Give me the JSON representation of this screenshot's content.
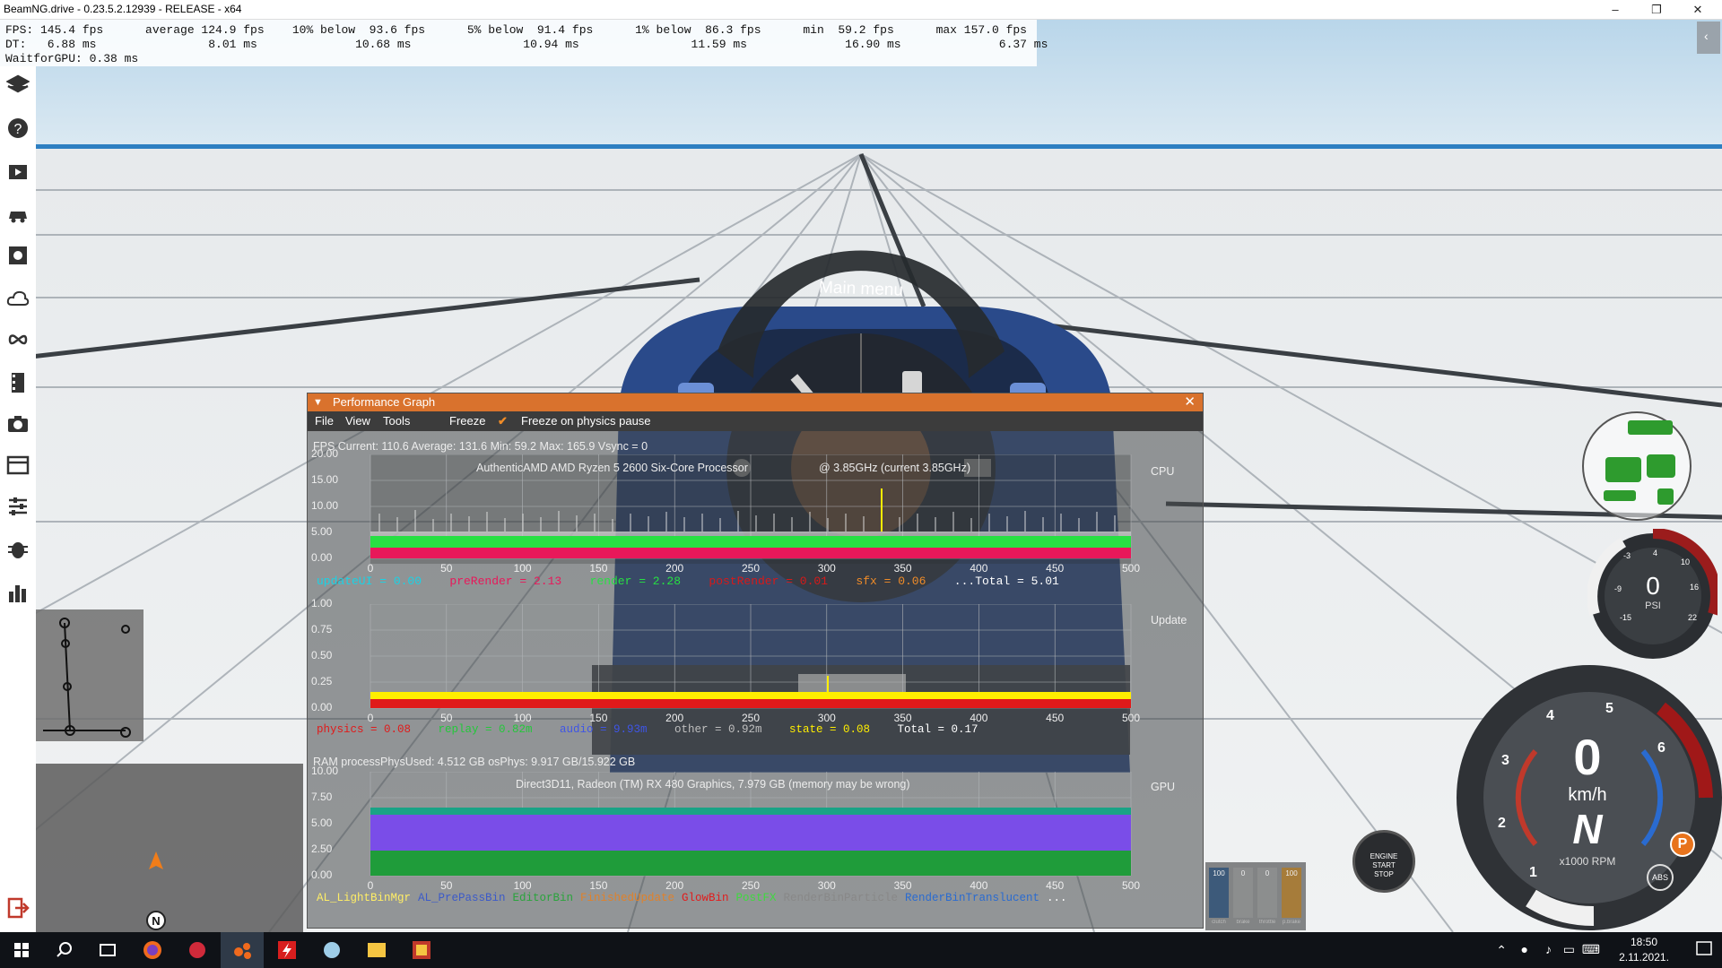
{
  "window": {
    "title": "BeamNG.drive - 0.23.5.2.12939 - RELEASE - x64",
    "min": "–",
    "max": "❐",
    "close": "✕"
  },
  "fps_overlay": {
    "line1": "FPS: 145.4 fps      average 124.9 fps    10% below  93.6 fps      5% below  91.4 fps      1% below  86.3 fps      min  59.2 fps      max 157.0 fps",
    "line2": "DT:   6.88 ms                8.01 ms              10.68 ms                10.94 ms                11.59 ms              16.90 ms              6.37 ms",
    "line3": "WaitforGPU: 0.38 ms"
  },
  "radial_menu": {
    "title": "Main menu"
  },
  "perf": {
    "title": "Performance Graph",
    "menu": {
      "file": "File",
      "view": "View",
      "tools": "Tools",
      "freeze": "Freeze",
      "freeze_physics": "Freeze on physics pause"
    },
    "fps_line": "FPS  Current: 110.6  Average: 131.6  Min: 59.2  Max: 165.9 Vsync = 0",
    "cpu_label": "CPU",
    "update_label": "Update",
    "gpu_label": "GPU",
    "cpu_name": "AuthenticAMD AMD Ryzen 5 2600 Six-Core Processor",
    "cpu_clock": "@ 3.85GHz (current 3.85GHz)",
    "gpu_name": "Direct3D11, Radeon (TM) RX 480 Graphics, 7.979 GB (memory may be wrong)",
    "ram_line": "RAM  processPhysUsed: 4.512 GB  osPhys: 9.917 GB/15.922 GB",
    "x_ticks": [
      "0",
      "50",
      "100",
      "150",
      "200",
      "250",
      "300",
      "350",
      "400",
      "450",
      "500"
    ],
    "cpu_y": [
      "20.00",
      "15.00",
      "10.00",
      "5.00",
      "0.00"
    ],
    "upd_y": [
      "1.00",
      "0.75",
      "0.50",
      "0.25",
      "0.00"
    ],
    "gpu_y": [
      "10.00",
      "7.50",
      "5.00",
      "2.50",
      "0.00"
    ],
    "cpu_legend": [
      {
        "t": "updateUI =    0.00",
        "c": "#19d3e6"
      },
      {
        "t": "preRender =    2.13",
        "c": "#e8185a"
      },
      {
        "t": "render =    2.28",
        "c": "#27e043"
      },
      {
        "t": "postRender =    0.01",
        "c": "#d81919"
      },
      {
        "t": "sfx =    0.06",
        "c": "#f08c28"
      },
      {
        "t": "...Total = 5.01",
        "c": "#ffffff"
      }
    ],
    "upd_legend": [
      {
        "t": "physics =    0.08",
        "c": "#e01a1a"
      },
      {
        "t": "replay =    0.82m",
        "c": "#23c83a"
      },
      {
        "t": "audio =    9.93m",
        "c": "#3f55e6"
      },
      {
        "t": "other =    0.92m",
        "c": "#bfbfbf"
      },
      {
        "t": "state =    0.08",
        "c": "#ffee00"
      },
      {
        "t": "Total = 0.17",
        "c": "#ffffff"
      }
    ],
    "gpu_legend": [
      {
        "t": "AL_LightBinMgr",
        "c": "#ffee66"
      },
      {
        "t": "AL_PrePassBin",
        "c": "#3c5ac8"
      },
      {
        "t": "EditorBin",
        "c": "#2aa43c"
      },
      {
        "t": "FinishedUpdate",
        "c": "#e0812a"
      },
      {
        "t": "GlowBin",
        "c": "#e11d1d"
      },
      {
        "t": "PostFX",
        "c": "#3fd93f"
      },
      {
        "t": "RenderBinParticle",
        "c": "#888888"
      },
      {
        "t": "RenderBinTranslucent",
        "c": "#2a6bd0"
      },
      {
        "t": "...",
        "c": "#ffffff"
      }
    ]
  },
  "gauges": {
    "speed": "0",
    "speed_unit": "km/h",
    "gear": "N",
    "rpm_unit": "x1000 RPM",
    "rpm_ticks": [
      "1",
      "2",
      "3",
      "4",
      "5",
      "6"
    ],
    "boost": "0",
    "boost_unit": "PSI",
    "boost_ticks": [
      "-3",
      "4",
      "10",
      "-9",
      "16",
      "-15",
      "22"
    ],
    "abs": "ABS",
    "park": "P",
    "engine_btn": [
      "ENGINE",
      "START",
      "STOP"
    ],
    "pedals": [
      {
        "v": "100",
        "l": "clutch"
      },
      {
        "v": "0",
        "l": "brake"
      },
      {
        "v": "0",
        "l": "throttle"
      },
      {
        "v": "100",
        "l": "p.brake"
      }
    ]
  },
  "map": {
    "north": "N"
  },
  "tray": {
    "time": "18:50",
    "date": "2.11.2021."
  }
}
